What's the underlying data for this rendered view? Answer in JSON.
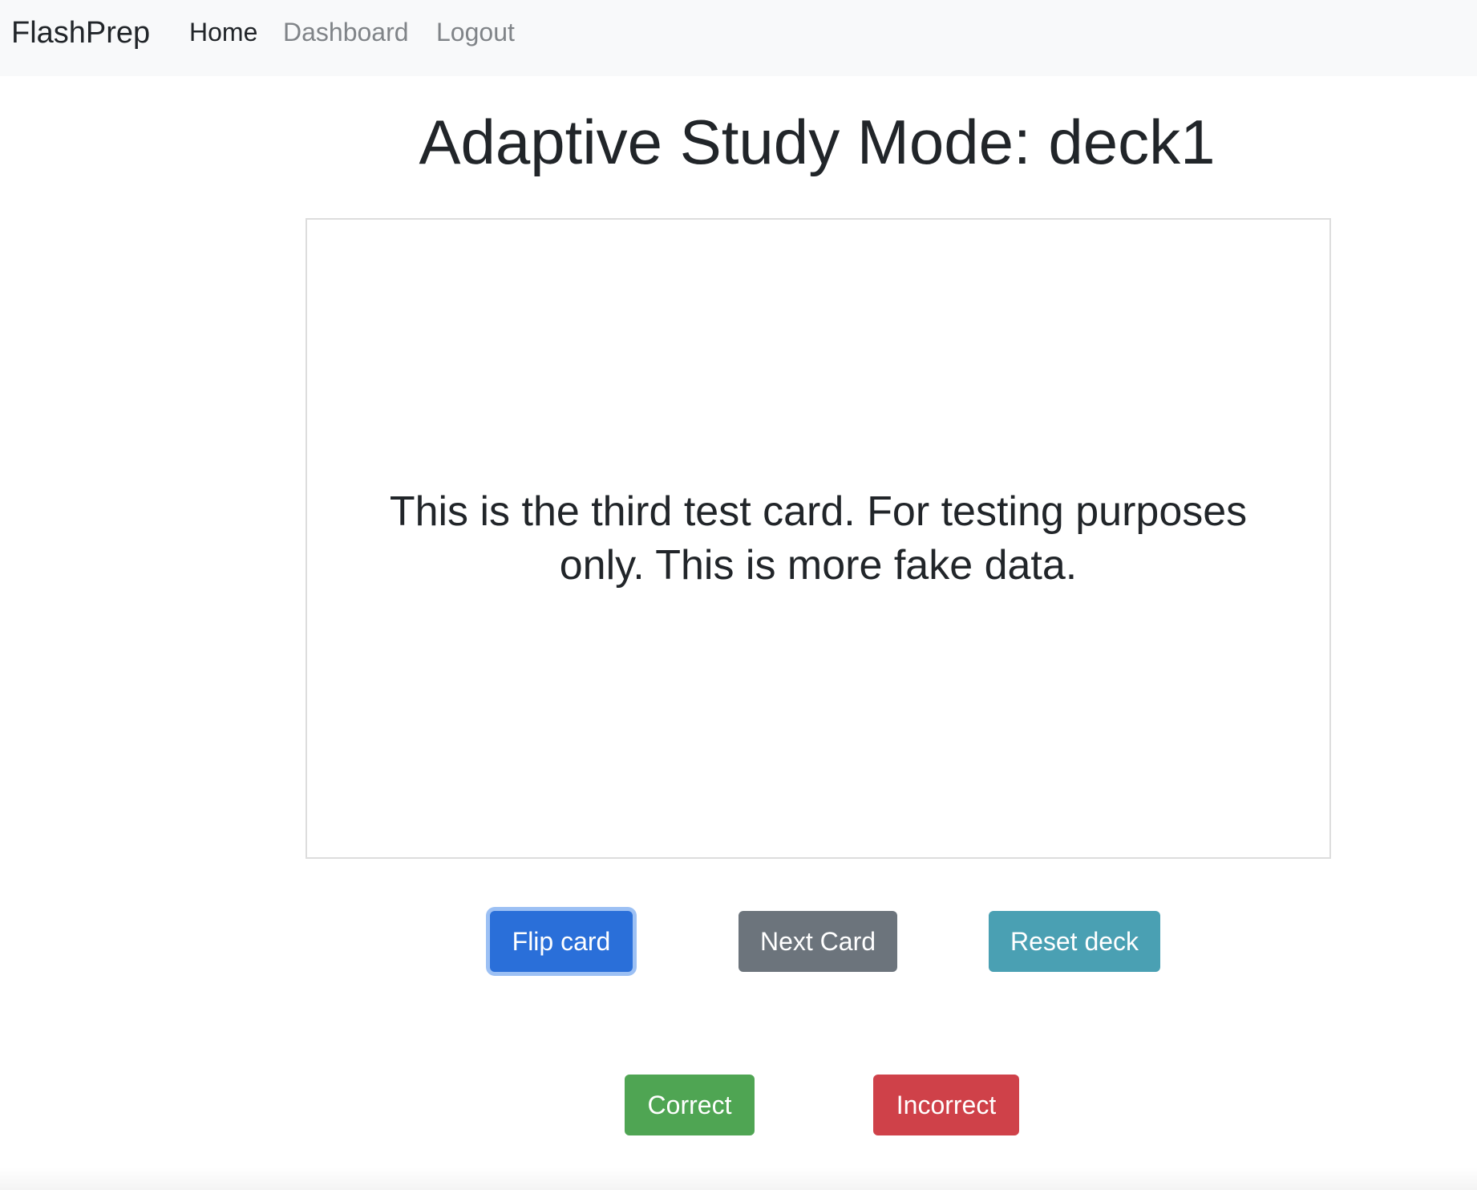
{
  "navbar": {
    "brand": "FlashPrep",
    "links": [
      {
        "label": "Home",
        "active": true
      },
      {
        "label": "Dashboard",
        "active": false
      },
      {
        "label": "Logout",
        "active": false
      }
    ]
  },
  "main": {
    "title": "Adaptive Study Mode: deck1",
    "card_text": "This is the third test card. For testing purposes only. This is more fake data.",
    "buttons": {
      "flip": "Flip card",
      "next": "Next Card",
      "reset": "Reset deck",
      "correct": "Correct",
      "incorrect": "Incorrect"
    }
  },
  "colors": {
    "navbar_bg": "#f8f9fa",
    "primary": "#2a6fd9",
    "secondary": "#6c747c",
    "info": "#4aa0b3",
    "success": "#4fa553",
    "danger": "#cf4149"
  }
}
